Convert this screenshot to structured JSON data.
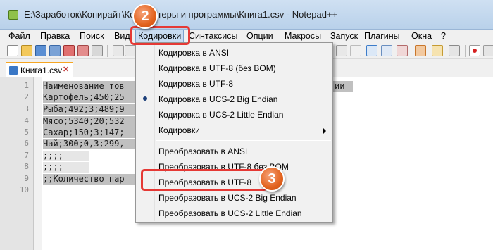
{
  "window": {
    "title": "E:\\Заработок\\Копирайт\\Компьютеры и программы\\Книга1.csv - Notepad++"
  },
  "menubar": {
    "items": [
      "Файл",
      "Правка",
      "Поиск",
      "Вид",
      "Кодировки",
      "Синтаксисы",
      "Опции",
      "Макросы",
      "Запуск",
      "Плагины",
      "Окна",
      "?"
    ],
    "active": "Кодировки"
  },
  "tab": {
    "label": "Книга1.csv",
    "close": "✕"
  },
  "editor": {
    "line_numbers": [
      "1",
      "2",
      "3",
      "4",
      "5",
      "6",
      "7",
      "8",
      "9",
      "10"
    ],
    "lines": [
      "Наименование тов",
      "Картофель;450;25",
      "Рыба;492;3;489;9",
      "Мясо;5340;20;532",
      "Сахар;150;3;147;",
      "Чай;300;0,3;299,",
      ";;;;",
      ";;;;",
      ";;Количество пар",
      ""
    ],
    "line1_tail": "ии"
  },
  "dropdown": {
    "items": [
      "Кодировка в ANSI",
      "Кодировка в UTF-8 (без BOM)",
      "Кодировка в UTF-8",
      "Кодировка в UCS-2 Big Endian",
      "Кодировка в UCS-2 Little Endian",
      "Кодировки",
      "Преобразовать в ANSI",
      "Преобразовать в UTF-8 без BOM",
      "Преобразовать в UTF-8",
      "Преобразовать в UCS-2 Big Endian",
      "Преобразовать в UCS-2 Little Endian"
    ],
    "selected": "Кодировка в UCS-2 Big Endian"
  },
  "annotations": {
    "step2": "2",
    "step3": "3"
  },
  "colors": {
    "highlight": "#e53935",
    "badge": "#e2621d",
    "bullet": "#1c3f7a"
  }
}
